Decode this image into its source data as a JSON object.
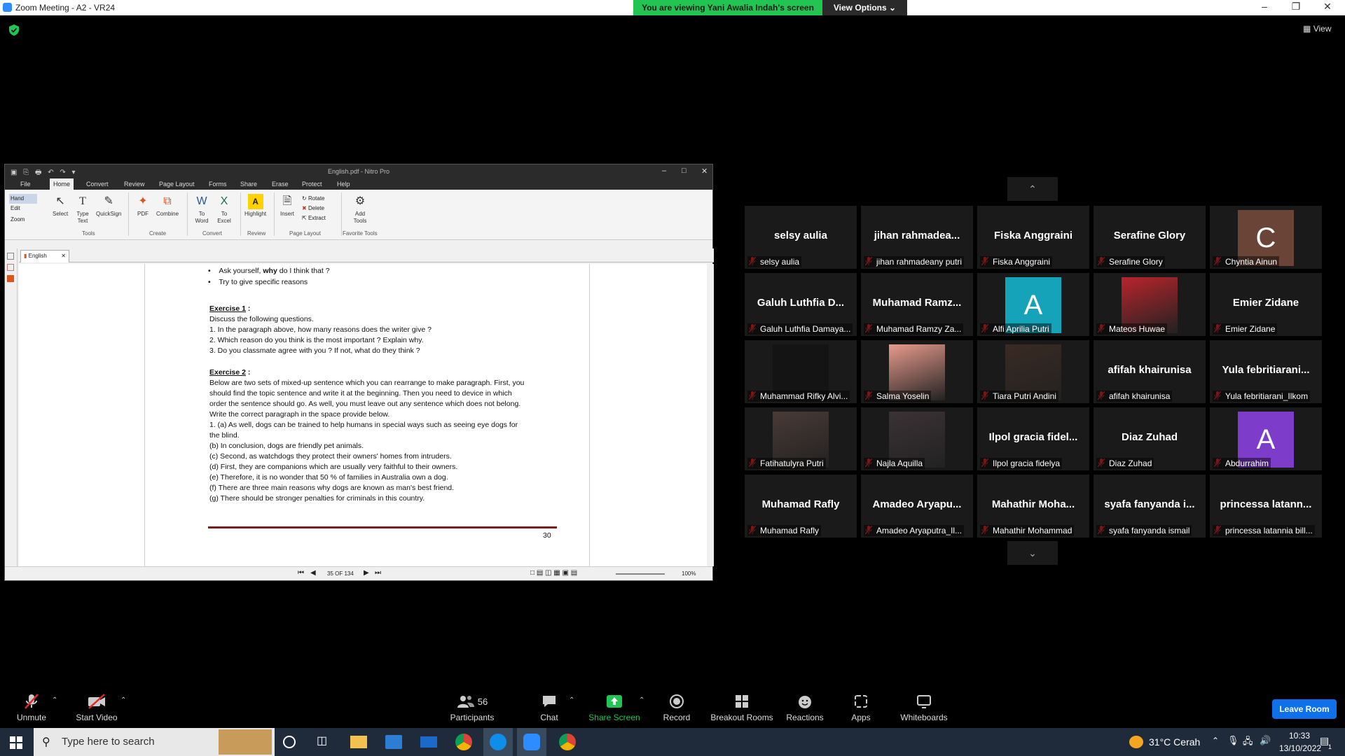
{
  "zoom": {
    "window_title": "Zoom Meeting - A2 - VR24",
    "viewing_banner": "You are viewing Yani Awalia Indah's screen",
    "view_options": "View Options",
    "view_label": "View"
  },
  "nitro": {
    "title": "English.pdf - Nitro Pro",
    "menu": [
      "File",
      "Home",
      "Convert",
      "Review",
      "Page Layout",
      "Forms",
      "Share",
      "Erase",
      "Protect",
      "Help"
    ],
    "left_tools": [
      "Hand",
      "Edit",
      "Zoom"
    ],
    "ribbon": {
      "select": "Select",
      "type_text_1": "Type",
      "type_text_2": "Text",
      "quicksign": "QuickSign",
      "pdf": "PDF",
      "combine": "Combine",
      "to_word_1": "To",
      "to_word_2": "Word",
      "to_excel_1": "To",
      "to_excel_2": "Excel",
      "highlight": "Highlight",
      "insert": "Insert",
      "rotate": "Rotate",
      "delete": "Delete",
      "extract": "Extract",
      "add_tools_1": "Add",
      "add_tools_2": "Tools"
    },
    "groups": [
      "Tools",
      "Create",
      "Convert",
      "Review",
      "Page Layout",
      "Favorite Tools"
    ],
    "doc_tab": "English",
    "page_indicator": "35 OF 134",
    "zoom_level": "100%"
  },
  "doc": {
    "bullet1_pre": "Ask yourself, ",
    "bullet1_em": "why",
    "bullet1_post": " do I think that ?",
    "bullet2": "Try to give specific reasons",
    "ex1_title": "Exercise 1",
    "ex1_colon": " :",
    "ex1_intro": "Discuss the following questions.",
    "ex1_items": [
      "1.    In the paragraph above, how many reasons does the writer give ?",
      "2.    Which reason do you think is the most important ? Explain why.",
      "3.    Do you classmate agree with you ? If not, what do they think ?"
    ],
    "ex2_title": "Exercise 2",
    "ex2_colon": " :",
    "ex2_lines": [
      "Below are two sets of mixed-up sentence which you can rearrange to make paragraph. First, you",
      "should find the topic sentence and write it at the beginning. Then you need to device in which",
      "order the sentence should go. As well, you must leave out any sentence which does not belong.",
      "Write the correct paragraph in the space provide below.",
      "1.    (a) As well, dogs can be trained to help humans in special ways such as seeing eye   dogs for",
      "        the blind.",
      "(b) In conclusion, dogs are friendly pet animals.",
      "(c) Second, as watchdogs they protect their owners' homes from intruders.",
      "(d) First, they are companions which are usually very faithful to their owners.",
      "(e) Therefore, it is no wonder that 50 % of families in Australia own a dog.",
      "(f) There are three main reasons why dogs are known as man's best friend.",
      "(g) There should be stronger penalties for criminals in this country."
    ],
    "page_number": "30"
  },
  "participants": [
    {
      "big": "selsy aulia",
      "name": "selsy aulia",
      "type": "text"
    },
    {
      "big": "jihan  rahmadea...",
      "name": "jihan rahmadeany putri",
      "type": "text"
    },
    {
      "big": "Fiska Anggraini",
      "name": "Fiska Anggraini",
      "type": "text"
    },
    {
      "big": "Serafine Glory",
      "name": "Serafine Glory",
      "type": "text"
    },
    {
      "big": "C",
      "name": "Chyntia Ainun",
      "type": "avatar",
      "color": "#6b4438"
    },
    {
      "big": "Galuh Luthfia D...",
      "name": "Galuh Luthfia Damaya...",
      "type": "text"
    },
    {
      "big": "Muhamad  Ramz...",
      "name": "Muhamad Ramzy Za...",
      "type": "text"
    },
    {
      "big": "A",
      "name": "Alfi Aprilia Putri",
      "type": "avatar",
      "color": "#14a3b8"
    },
    {
      "big": "",
      "name": "Mateos Huwae",
      "type": "photo",
      "color": "#b8242b"
    },
    {
      "big": "Emier Zidane",
      "name": "Emier Zidane",
      "type": "text"
    },
    {
      "big": "",
      "name": "Muhammad Rifky Alvi...",
      "type": "dark"
    },
    {
      "big": "",
      "name": "Salma Yoselin",
      "type": "photo",
      "color": "#e79a8c"
    },
    {
      "big": "",
      "name": "Tiara Putri Andini",
      "type": "photo",
      "color": "#3a2a22"
    },
    {
      "big": "afifah khairunisa",
      "name": "afifah khairunisa",
      "type": "text"
    },
    {
      "big": "Yula  febritiarani...",
      "name": "Yula febritiarani_Ilkom",
      "type": "text"
    },
    {
      "big": "",
      "name": "Fatihatulyra Putri",
      "type": "photo",
      "color": "#4a3a36"
    },
    {
      "big": "",
      "name": "Najla Aquilla",
      "type": "photo",
      "color": "#3b3236"
    },
    {
      "big": "Ilpol  gracia  fidel...",
      "name": "Ilpol gracia fidelya",
      "type": "text"
    },
    {
      "big": "Diaz Zuhad",
      "name": "Diaz Zuhad",
      "type": "text"
    },
    {
      "big": "A",
      "name": "Abdurrahim",
      "type": "avatar",
      "color": "#7d3cc9"
    },
    {
      "big": "Muhamad Rafly",
      "name": "Muhamad Rafly",
      "type": "text"
    },
    {
      "big": "Amadeo  Aryapu...",
      "name": "Amadeo Aryaputra_Il...",
      "type": "text"
    },
    {
      "big": "Mahathir  Moha...",
      "name": "Mahathir Mohammad",
      "type": "text"
    },
    {
      "big": "syafa  fanyanda  i...",
      "name": "syafa fanyanda ismail",
      "type": "text"
    },
    {
      "big": "princessa  latann...",
      "name": "princessa latannia bill...",
      "type": "text"
    }
  ],
  "toolbar": {
    "unmute": "Unmute",
    "start_video": "Start Video",
    "participants": "Participants",
    "participants_count": "56",
    "chat": "Chat",
    "share_screen": "Share Screen",
    "record": "Record",
    "breakout": "Breakout Rooms",
    "reactions": "Reactions",
    "apps": "Apps",
    "whiteboards": "Whiteboards",
    "leave": "Leave Room"
  },
  "taskbar": {
    "search_placeholder": "Type here to search",
    "weather": "31°C  Cerah",
    "time": "10:33",
    "date": "13/10/2022",
    "notif_count": "1"
  },
  "colors": {
    "share_green": "#23c552",
    "leave_blue": "#0e71eb",
    "mute_red": "#e02828"
  }
}
